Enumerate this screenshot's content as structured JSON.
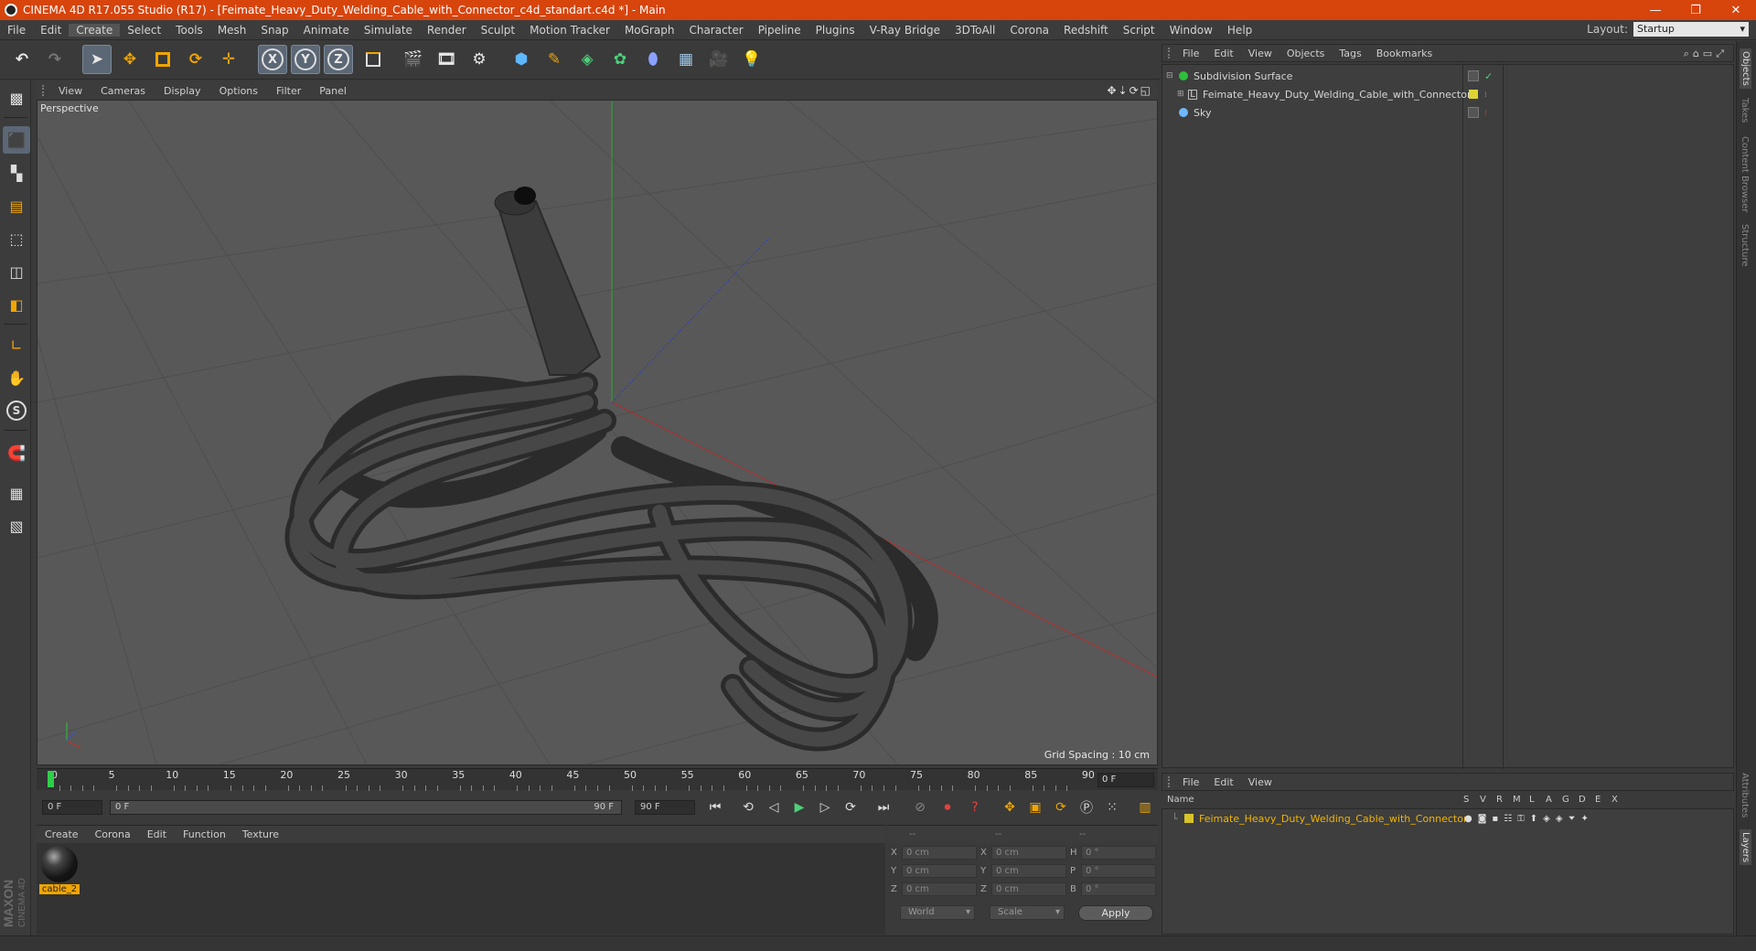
{
  "titlebar": {
    "title": "CINEMA 4D R17.055 Studio (R17) - [Feimate_Heavy_Duty_Welding_Cable_with_Connector_c4d_standart.c4d *] - Main",
    "accent": "#d7440c"
  },
  "menu": {
    "items": [
      "File",
      "Edit",
      "Create",
      "Select",
      "Tools",
      "Mesh",
      "Snap",
      "Animate",
      "Simulate",
      "Render",
      "Sculpt",
      "Motion Tracker",
      "MoGraph",
      "Character",
      "Pipeline",
      "Plugins",
      "V-Ray Bridge",
      "3DToAll",
      "Corona",
      "Redshift",
      "Script",
      "Window",
      "Help"
    ],
    "active": "Create",
    "layout_label": "Layout:",
    "layout_value": "Startup"
  },
  "toolbar": {
    "axis_x": "X",
    "axis_y": "Y",
    "axis_z": "Z",
    "icons": [
      "undo-icon",
      "redo-icon",
      "select-arrow-icon",
      "move-icon",
      "scale-icon",
      "rotate-icon",
      "live-select-icon",
      "x-axis-icon",
      "y-axis-icon",
      "z-axis-icon",
      "world-coord-icon",
      "render-view-icon",
      "render-picture-viewer-icon",
      "render-settings-icon",
      "cube-icon",
      "pen-icon",
      "subdivision-icon",
      "cloner-icon",
      "deformer-icon",
      "floor-icon",
      "camera-icon",
      "light-icon"
    ]
  },
  "left_toolbar": {
    "icons": [
      "make-editable-icon",
      "model-mode-icon",
      "texture-mode-icon",
      "workplane-icon",
      "points-mode-icon",
      "edges-mode-icon",
      "polygons-mode-icon",
      "axis-icon",
      "tweak-icon",
      "solo-icon",
      "magnet-icon",
      "snap-grid-icon",
      "snap-lock-icon"
    ]
  },
  "viewport": {
    "menu": [
      "View",
      "Cameras",
      "Display",
      "Options",
      "Filter",
      "Panel"
    ],
    "label": "Perspective",
    "grid_spacing": "Grid Spacing : 10 cm"
  },
  "timeline": {
    "ticks": [
      "0",
      "5",
      "10",
      "15",
      "20",
      "25",
      "30",
      "35",
      "40",
      "45",
      "50",
      "55",
      "60",
      "65",
      "70",
      "75",
      "80",
      "85",
      "90"
    ],
    "current_frame": "0 F",
    "start_field": "0 F",
    "range_start": "0 F",
    "range_end": "90 F",
    "end_field": "90 F"
  },
  "material_manager": {
    "menu": [
      "Create",
      "Corona",
      "Edit",
      "Function",
      "Texture"
    ],
    "material_name": "cable_2"
  },
  "coordinates": {
    "header": [
      "--",
      "--",
      "--"
    ],
    "rows": [
      {
        "axis": "X",
        "pos": "0 cm",
        "axis2": "X",
        "size": "0 cm",
        "rot_label": "H",
        "rot": "0 °"
      },
      {
        "axis": "Y",
        "pos": "0 cm",
        "axis2": "Y",
        "size": "0 cm",
        "rot_label": "P",
        "rot": "0 °"
      },
      {
        "axis": "Z",
        "pos": "0 cm",
        "axis2": "Z",
        "size": "0 cm",
        "rot_label": "B",
        "rot": "0 °"
      }
    ],
    "mode": "World",
    "scale_mode": "Scale",
    "apply_label": "Apply"
  },
  "object_manager": {
    "menu": [
      "File",
      "Edit",
      "View",
      "Objects",
      "Tags",
      "Bookmarks"
    ],
    "objects": [
      {
        "name": "Subdivision Surface",
        "icon": "subdivision-surface-icon"
      },
      {
        "name": "Feimate_Heavy_Duty_Welding_Cable_with_Connector",
        "icon": "polygon-object-icon"
      },
      {
        "name": "Sky",
        "icon": "sky-icon"
      }
    ]
  },
  "layer_manager": {
    "menu": [
      "File",
      "Edit",
      "View"
    ],
    "columns": [
      "Name",
      "S",
      "V",
      "R",
      "M",
      "L",
      "A",
      "G",
      "D",
      "E",
      "X"
    ],
    "layers": [
      {
        "name": "Feimate_Heavy_Duty_Welding_Cable_with_Connector",
        "color": "#d8c42a"
      }
    ]
  },
  "right_tabs": [
    "Objects",
    "Takes",
    "Content Browser",
    "Structure",
    "Attributes",
    "Layers"
  ],
  "logo": {
    "brand": "MAXON",
    "product": "CINEMA 4D"
  }
}
